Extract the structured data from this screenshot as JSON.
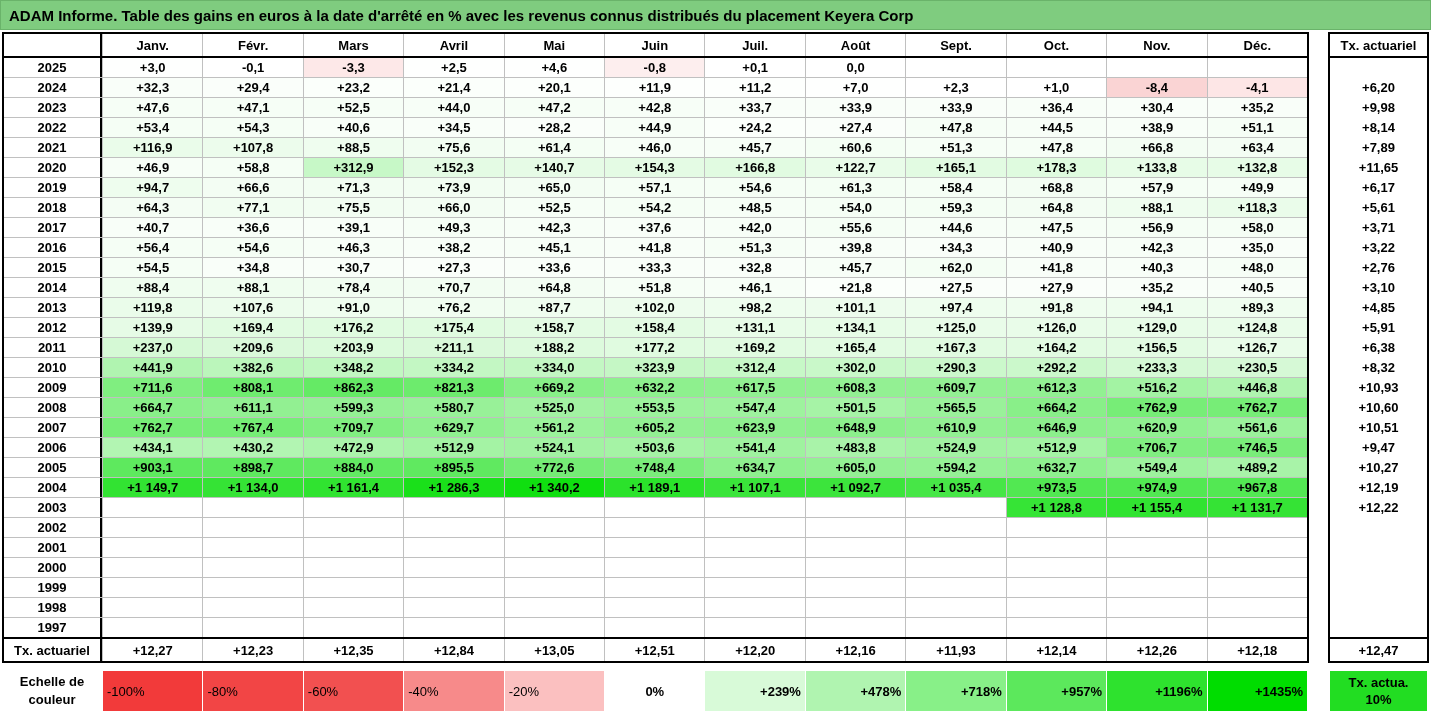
{
  "title": "ADAM Informe. Table des gains en euros à la date d'arrêté en % avec les revenus connus distribués du placement Keyera Corp",
  "columns": [
    "Janv.",
    "Févr.",
    "Mars",
    "Avril",
    "Mai",
    "Juin",
    "Juil.",
    "Août",
    "Sept.",
    "Oct.",
    "Nov.",
    "Déc."
  ],
  "rate_header": "Tx. actuariel",
  "rows": [
    {
      "year": "2025",
      "cells": [
        {
          "text": "+3,0",
          "color": "#fefffe"
        },
        {
          "text": "-0,1",
          "color": "#ffffff"
        },
        {
          "text": "-3,3",
          "color": "#fde8e8"
        },
        {
          "text": "+2,5",
          "color": "#fefffe"
        },
        {
          "text": "+4,6",
          "color": "#fefffe"
        },
        {
          "text": "-0,8",
          "color": "#fdeeee"
        },
        {
          "text": "+0,1",
          "color": "#ffffff"
        },
        {
          "text": "0,0",
          "color": "#ffffff"
        },
        null,
        null,
        null,
        null
      ]
    },
    {
      "year": "2024",
      "cells": [
        {
          "text": "+32,3",
          "color": "#f9fef9"
        },
        {
          "text": "+29,4",
          "color": "#fafefa"
        },
        {
          "text": "+23,2",
          "color": "#fbfffb"
        },
        {
          "text": "+21,4",
          "color": "#fbfffb"
        },
        {
          "text": "+20,1",
          "color": "#fcfffc"
        },
        {
          "text": "+11,9",
          "color": "#fdfffd"
        },
        {
          "text": "+11,2",
          "color": "#fdfffd"
        },
        {
          "text": "+7,0",
          "color": "#fefffe"
        },
        {
          "text": "+2,3",
          "color": "#ffffff"
        },
        {
          "text": "+1,0",
          "color": "#ffffff"
        },
        {
          "text": "-8,4",
          "color": "#fad4d4"
        },
        {
          "text": "-4,1",
          "color": "#fde6e6"
        }
      ],
      "rate": "+6,20"
    },
    {
      "year": "2023",
      "cells": [
        {
          "text": "+47,6",
          "color": "#f6fef6"
        },
        {
          "text": "+47,1",
          "color": "#f6fef6"
        },
        {
          "text": "+52,5",
          "color": "#f6fef6"
        },
        {
          "text": "+44,0",
          "color": "#f7fef7"
        },
        {
          "text": "+47,2",
          "color": "#f6fef6"
        },
        {
          "text": "+42,8",
          "color": "#f7fef7"
        },
        {
          "text": "+33,7",
          "color": "#f9fef9"
        },
        {
          "text": "+33,9",
          "color": "#f9fef9"
        },
        {
          "text": "+33,9",
          "color": "#f9fef9"
        },
        {
          "text": "+36,4",
          "color": "#f8fef8"
        },
        {
          "text": "+30,4",
          "color": "#f9fef9"
        },
        {
          "text": "+35,2",
          "color": "#f9fef9"
        }
      ],
      "rate": "+9,98"
    },
    {
      "year": "2022",
      "cells": [
        {
          "text": "+53,4",
          "color": "#f5fef5"
        },
        {
          "text": "+54,3",
          "color": "#f5fef5"
        },
        {
          "text": "+40,6",
          "color": "#f8fef8"
        },
        {
          "text": "+34,5",
          "color": "#f9fef9"
        },
        {
          "text": "+28,2",
          "color": "#fafefa"
        },
        {
          "text": "+44,9",
          "color": "#f7fef7"
        },
        {
          "text": "+24,2",
          "color": "#fbfffb"
        },
        {
          "text": "+27,4",
          "color": "#fafefa"
        },
        {
          "text": "+47,8",
          "color": "#f6fef6"
        },
        {
          "text": "+44,5",
          "color": "#f7fef7"
        },
        {
          "text": "+38,9",
          "color": "#f8fef8"
        },
        {
          "text": "+51,1",
          "color": "#f6fef6"
        }
      ],
      "rate": "+8,14"
    },
    {
      "year": "2021",
      "cells": [
        {
          "text": "+116,9",
          "color": "#eafcea"
        },
        {
          "text": "+107,8",
          "color": "#ecfcec"
        },
        {
          "text": "+88,5",
          "color": "#effdef"
        },
        {
          "text": "+75,6",
          "color": "#f2fdf2"
        },
        {
          "text": "+61,4",
          "color": "#f4fef4"
        },
        {
          "text": "+46,0",
          "color": "#f7fef7"
        },
        {
          "text": "+45,7",
          "color": "#f7fef7"
        },
        {
          "text": "+60,6",
          "color": "#f4fef4"
        },
        {
          "text": "+51,3",
          "color": "#f6fef6"
        },
        {
          "text": "+47,8",
          "color": "#f6fef6"
        },
        {
          "text": "+66,8",
          "color": "#f3fdf3"
        },
        {
          "text": "+63,4",
          "color": "#f4fdf4"
        }
      ],
      "rate": "+7,89"
    },
    {
      "year": "2020",
      "cells": [
        {
          "text": "+46,9",
          "color": "#f7fef7"
        },
        {
          "text": "+58,8",
          "color": "#f5fef5"
        },
        {
          "text": "+312,9",
          "color": "#c7f8c7"
        },
        {
          "text": "+152,3",
          "color": "#e4fbe4"
        },
        {
          "text": "+140,7",
          "color": "#e6fbe6"
        },
        {
          "text": "+154,3",
          "color": "#e4fbe4"
        },
        {
          "text": "+166,8",
          "color": "#e1fbe1"
        },
        {
          "text": "+122,7",
          "color": "#e9fce9"
        },
        {
          "text": "+165,1",
          "color": "#e2fbe2"
        },
        {
          "text": "+178,3",
          "color": "#dffbdf"
        },
        {
          "text": "+133,8",
          "color": "#e7fce7"
        },
        {
          "text": "+132,8",
          "color": "#e7fce7"
        }
      ],
      "rate": "+11,65"
    },
    {
      "year": "2019",
      "cells": [
        {
          "text": "+94,7",
          "color": "#eefdee"
        },
        {
          "text": "+66,6",
          "color": "#f3fdf3"
        },
        {
          "text": "+71,3",
          "color": "#f2fdf2"
        },
        {
          "text": "+73,9",
          "color": "#f2fdf2"
        },
        {
          "text": "+65,0",
          "color": "#f3fdf3"
        },
        {
          "text": "+57,1",
          "color": "#f5fef5"
        },
        {
          "text": "+54,6",
          "color": "#f5fef5"
        },
        {
          "text": "+61,3",
          "color": "#f4fef4"
        },
        {
          "text": "+58,4",
          "color": "#f5fef5"
        },
        {
          "text": "+68,8",
          "color": "#f3fdf3"
        },
        {
          "text": "+57,9",
          "color": "#f5fef5"
        },
        {
          "text": "+49,9",
          "color": "#f6fef6"
        }
      ],
      "rate": "+6,17"
    },
    {
      "year": "2018",
      "cells": [
        {
          "text": "+64,3",
          "color": "#f4fdf4"
        },
        {
          "text": "+77,1",
          "color": "#f1fdf1"
        },
        {
          "text": "+75,5",
          "color": "#f2fdf2"
        },
        {
          "text": "+66,0",
          "color": "#f3fdf3"
        },
        {
          "text": "+52,5",
          "color": "#f6fef6"
        },
        {
          "text": "+54,2",
          "color": "#f5fef5"
        },
        {
          "text": "+48,5",
          "color": "#f6fef6"
        },
        {
          "text": "+54,0",
          "color": "#f5fef5"
        },
        {
          "text": "+59,3",
          "color": "#f4fef4"
        },
        {
          "text": "+64,8",
          "color": "#f3fdf3"
        },
        {
          "text": "+88,1",
          "color": "#effdef"
        },
        {
          "text": "+118,3",
          "color": "#eafcea"
        }
      ],
      "rate": "+5,61"
    },
    {
      "year": "2017",
      "cells": [
        {
          "text": "+40,7",
          "color": "#f8fef8"
        },
        {
          "text": "+36,6",
          "color": "#f8fef8"
        },
        {
          "text": "+39,1",
          "color": "#f8fef8"
        },
        {
          "text": "+49,3",
          "color": "#f6fef6"
        },
        {
          "text": "+42,3",
          "color": "#f7fef7"
        },
        {
          "text": "+37,6",
          "color": "#f8fef8"
        },
        {
          "text": "+42,0",
          "color": "#f7fef7"
        },
        {
          "text": "+55,6",
          "color": "#f5fef5"
        },
        {
          "text": "+44,6",
          "color": "#f7fef7"
        },
        {
          "text": "+47,5",
          "color": "#f6fef6"
        },
        {
          "text": "+56,9",
          "color": "#f5fef5"
        },
        {
          "text": "+58,0",
          "color": "#f5fef5"
        }
      ],
      "rate": "+3,71"
    },
    {
      "year": "2016",
      "cells": [
        {
          "text": "+56,4",
          "color": "#f5fef5"
        },
        {
          "text": "+54,6",
          "color": "#f5fef5"
        },
        {
          "text": "+46,3",
          "color": "#f7fef7"
        },
        {
          "text": "+38,2",
          "color": "#f8fef8"
        },
        {
          "text": "+45,1",
          "color": "#f7fef7"
        },
        {
          "text": "+41,8",
          "color": "#f8fef8"
        },
        {
          "text": "+51,3",
          "color": "#f6fef6"
        },
        {
          "text": "+39,8",
          "color": "#f8fef8"
        },
        {
          "text": "+34,3",
          "color": "#f9fef9"
        },
        {
          "text": "+40,9",
          "color": "#f8fef8"
        },
        {
          "text": "+42,3",
          "color": "#f7fef7"
        },
        {
          "text": "+35,0",
          "color": "#f9fef9"
        }
      ],
      "rate": "+3,22"
    },
    {
      "year": "2015",
      "cells": [
        {
          "text": "+54,5",
          "color": "#f5fef5"
        },
        {
          "text": "+34,8",
          "color": "#f9fef9"
        },
        {
          "text": "+30,7",
          "color": "#f9fef9"
        },
        {
          "text": "+27,3",
          "color": "#fafefa"
        },
        {
          "text": "+33,6",
          "color": "#f9fef9"
        },
        {
          "text": "+33,3",
          "color": "#f9fef9"
        },
        {
          "text": "+32,8",
          "color": "#f9fef9"
        },
        {
          "text": "+45,7",
          "color": "#f7fef7"
        },
        {
          "text": "+62,0",
          "color": "#f4fef4"
        },
        {
          "text": "+41,8",
          "color": "#f8fef8"
        },
        {
          "text": "+40,3",
          "color": "#f8fef8"
        },
        {
          "text": "+48,0",
          "color": "#f6fef6"
        }
      ],
      "rate": "+2,76"
    },
    {
      "year": "2014",
      "cells": [
        {
          "text": "+88,4",
          "color": "#effdef"
        },
        {
          "text": "+88,1",
          "color": "#effdef"
        },
        {
          "text": "+78,4",
          "color": "#f1fdf1"
        },
        {
          "text": "+70,7",
          "color": "#f2fdf2"
        },
        {
          "text": "+64,8",
          "color": "#f3fdf3"
        },
        {
          "text": "+51,8",
          "color": "#f6fef6"
        },
        {
          "text": "+46,1",
          "color": "#f7fef7"
        },
        {
          "text": "+21,8",
          "color": "#fbfffb"
        },
        {
          "text": "+27,5",
          "color": "#fafefa"
        },
        {
          "text": "+27,9",
          "color": "#fafefa"
        },
        {
          "text": "+35,2",
          "color": "#f9fef9"
        },
        {
          "text": "+40,5",
          "color": "#f8fef8"
        }
      ],
      "rate": "+3,10"
    },
    {
      "year": "2013",
      "cells": [
        {
          "text": "+119,8",
          "color": "#eafcea"
        },
        {
          "text": "+107,6",
          "color": "#ecfcec"
        },
        {
          "text": "+91,0",
          "color": "#effdef"
        },
        {
          "text": "+76,2",
          "color": "#f1fdf1"
        },
        {
          "text": "+87,7",
          "color": "#effdef"
        },
        {
          "text": "+102,0",
          "color": "#edfced"
        },
        {
          "text": "+98,2",
          "color": "#eefdee"
        },
        {
          "text": "+101,1",
          "color": "#edfced"
        },
        {
          "text": "+97,4",
          "color": "#eefdee"
        },
        {
          "text": "+91,8",
          "color": "#effdef"
        },
        {
          "text": "+94,1",
          "color": "#eefdee"
        },
        {
          "text": "+89,3",
          "color": "#effdef"
        }
      ],
      "rate": "+4,85"
    },
    {
      "year": "2012",
      "cells": [
        {
          "text": "+139,9",
          "color": "#e6fbe6"
        },
        {
          "text": "+169,4",
          "color": "#e1fbe1"
        },
        {
          "text": "+176,2",
          "color": "#e0fbe0"
        },
        {
          "text": "+175,4",
          "color": "#e0fbe0"
        },
        {
          "text": "+158,7",
          "color": "#e3fbe3"
        },
        {
          "text": "+158,4",
          "color": "#e3fbe3"
        },
        {
          "text": "+131,1",
          "color": "#e8fce8"
        },
        {
          "text": "+134,1",
          "color": "#e7fce7"
        },
        {
          "text": "+125,0",
          "color": "#e9fce9"
        },
        {
          "text": "+126,0",
          "color": "#e9fce9"
        },
        {
          "text": "+129,0",
          "color": "#e8fce8"
        },
        {
          "text": "+124,8",
          "color": "#e9fce9"
        }
      ],
      "rate": "+5,91"
    },
    {
      "year": "2011",
      "cells": [
        {
          "text": "+237,0",
          "color": "#d5f9d5"
        },
        {
          "text": "+209,6",
          "color": "#daf9da"
        },
        {
          "text": "+203,9",
          "color": "#dbfadb"
        },
        {
          "text": "+211,1",
          "color": "#daf9da"
        },
        {
          "text": "+188,2",
          "color": "#ddfadd"
        },
        {
          "text": "+177,2",
          "color": "#e0fbe0"
        },
        {
          "text": "+169,2",
          "color": "#e1fbe1"
        },
        {
          "text": "+165,4",
          "color": "#e2fbe2"
        },
        {
          "text": "+167,3",
          "color": "#e1fbe1"
        },
        {
          "text": "+164,2",
          "color": "#e2fbe2"
        },
        {
          "text": "+156,5",
          "color": "#e3fbe3"
        },
        {
          "text": "+126,7",
          "color": "#e9fce9"
        }
      ],
      "rate": "+6,38"
    },
    {
      "year": "2010",
      "cells": [
        {
          "text": "+441,9",
          "color": "#b0f4b0"
        },
        {
          "text": "+382,6",
          "color": "#bbf6bb"
        },
        {
          "text": "+348,2",
          "color": "#c1f7c1"
        },
        {
          "text": "+334,2",
          "color": "#c3f7c3"
        },
        {
          "text": "+334,0",
          "color": "#c3f7c3"
        },
        {
          "text": "+323,9",
          "color": "#c5f7c5"
        },
        {
          "text": "+312,4",
          "color": "#c7f8c7"
        },
        {
          "text": "+302,0",
          "color": "#c9f8c9"
        },
        {
          "text": "+290,3",
          "color": "#cbf8cb"
        },
        {
          "text": "+292,2",
          "color": "#cbf8cb"
        },
        {
          "text": "+233,3",
          "color": "#d5f9d5"
        },
        {
          "text": "+230,5",
          "color": "#d6f9d6"
        }
      ],
      "rate": "+8,32"
    },
    {
      "year": "2009",
      "cells": [
        {
          "text": "+711,6",
          "color": "#80ee80"
        },
        {
          "text": "+808,1",
          "color": "#6fec6f"
        },
        {
          "text": "+862,3",
          "color": "#65ea65"
        },
        {
          "text": "+821,3",
          "color": "#6deb6d"
        },
        {
          "text": "+669,2",
          "color": "#88ef88"
        },
        {
          "text": "+632,2",
          "color": "#8ef08e"
        },
        {
          "text": "+617,5",
          "color": "#91f091"
        },
        {
          "text": "+608,3",
          "color": "#93f093"
        },
        {
          "text": "+609,7",
          "color": "#93f093"
        },
        {
          "text": "+612,3",
          "color": "#92f092"
        },
        {
          "text": "+516,2",
          "color": "#a3f3a3"
        },
        {
          "text": "+446,8",
          "color": "#aff4af"
        }
      ],
      "rate": "+10,93"
    },
    {
      "year": "2008",
      "cells": [
        {
          "text": "+664,7",
          "color": "#89ef89"
        },
        {
          "text": "+611,1",
          "color": "#92f092"
        },
        {
          "text": "+599,3",
          "color": "#94f094"
        },
        {
          "text": "+580,7",
          "color": "#98f198"
        },
        {
          "text": "+525,0",
          "color": "#a2f2a2"
        },
        {
          "text": "+553,5",
          "color": "#9cf29c"
        },
        {
          "text": "+547,4",
          "color": "#9ef29e"
        },
        {
          "text": "+501,5",
          "color": "#a6f3a6"
        },
        {
          "text": "+565,5",
          "color": "#9af19a"
        },
        {
          "text": "+664,2",
          "color": "#89ef89"
        },
        {
          "text": "+762,9",
          "color": "#77ed77"
        },
        {
          "text": "+762,7",
          "color": "#77ed77"
        }
      ],
      "rate": "+10,60"
    },
    {
      "year": "2007",
      "cells": [
        {
          "text": "+762,7",
          "color": "#77ed77"
        },
        {
          "text": "+767,4",
          "color": "#76ed76"
        },
        {
          "text": "+709,7",
          "color": "#81ee81"
        },
        {
          "text": "+629,7",
          "color": "#8ff08f"
        },
        {
          "text": "+561,2",
          "color": "#9bf29b"
        },
        {
          "text": "+605,2",
          "color": "#93f093"
        },
        {
          "text": "+623,9",
          "color": "#90f090"
        },
        {
          "text": "+648,9",
          "color": "#8cef8c"
        },
        {
          "text": "+610,9",
          "color": "#92f092"
        },
        {
          "text": "+646,9",
          "color": "#8cef8c"
        },
        {
          "text": "+620,9",
          "color": "#90f090"
        },
        {
          "text": "+561,6",
          "color": "#9bf29b"
        }
      ],
      "rate": "+10,51"
    },
    {
      "year": "2006",
      "cells": [
        {
          "text": "+434,1",
          "color": "#b2f5b2"
        },
        {
          "text": "+430,2",
          "color": "#b2f5b2"
        },
        {
          "text": "+472,9",
          "color": "#abf4ab"
        },
        {
          "text": "+512,9",
          "color": "#a4f3a4"
        },
        {
          "text": "+524,1",
          "color": "#a2f2a2"
        },
        {
          "text": "+503,6",
          "color": "#a5f3a5"
        },
        {
          "text": "+541,4",
          "color": "#9ff29f"
        },
        {
          "text": "+483,8",
          "color": "#a9f3a9"
        },
        {
          "text": "+524,9",
          "color": "#a2f2a2"
        },
        {
          "text": "+512,9",
          "color": "#a4f3a4"
        },
        {
          "text": "+706,7",
          "color": "#81ee81"
        },
        {
          "text": "+746,5",
          "color": "#7aed7a"
        }
      ],
      "rate": "+9,47"
    },
    {
      "year": "2005",
      "cells": [
        {
          "text": "+903,1",
          "color": "#5ee95e"
        },
        {
          "text": "+898,7",
          "color": "#5fe95f"
        },
        {
          "text": "+884,0",
          "color": "#62ea62"
        },
        {
          "text": "+895,5",
          "color": "#60e960"
        },
        {
          "text": "+772,6",
          "color": "#75ec75"
        },
        {
          "text": "+748,4",
          "color": "#7aed7a"
        },
        {
          "text": "+634,7",
          "color": "#8ef08e"
        },
        {
          "text": "+605,0",
          "color": "#93f093"
        },
        {
          "text": "+594,2",
          "color": "#95f195"
        },
        {
          "text": "+632,7",
          "color": "#8ef08e"
        },
        {
          "text": "+549,4",
          "color": "#9df29d"
        },
        {
          "text": "+489,2",
          "color": "#a8f3a8"
        }
      ],
      "rate": "+10,27"
    },
    {
      "year": "2004",
      "cells": [
        {
          "text": "+1 149,7",
          "color": "#32e332"
        },
        {
          "text": "+1 134,0",
          "color": "#35e335"
        },
        {
          "text": "+1 161,4",
          "color": "#30e330"
        },
        {
          "text": "+1 286,3",
          "color": "#1ae01a"
        },
        {
          "text": "+1 340,2",
          "color": "#10df10"
        },
        {
          "text": "+1 189,1",
          "color": "#2be22b"
        },
        {
          "text": "+1 107,1",
          "color": "#3ae43a"
        },
        {
          "text": "+1 092,7",
          "color": "#3ce43c"
        },
        {
          "text": "+1 035,4",
          "color": "#47e647"
        },
        {
          "text": "+973,5",
          "color": "#52e852"
        },
        {
          "text": "+974,9",
          "color": "#52e852"
        },
        {
          "text": "+967,8",
          "color": "#53e853"
        }
      ],
      "rate": "+12,19"
    },
    {
      "year": "2003",
      "cells": [
        null,
        null,
        null,
        null,
        null,
        null,
        null,
        null,
        null,
        {
          "text": "+1 128,8",
          "color": "#36e436"
        },
        {
          "text": "+1 155,4",
          "color": "#31e331"
        },
        {
          "text": "+1 131,7",
          "color": "#35e335"
        }
      ],
      "rate": "+12,22"
    },
    {
      "year": "2002",
      "cells": [
        null,
        null,
        null,
        null,
        null,
        null,
        null,
        null,
        null,
        null,
        null,
        null
      ]
    },
    {
      "year": "2001",
      "cells": [
        null,
        null,
        null,
        null,
        null,
        null,
        null,
        null,
        null,
        null,
        null,
        null
      ]
    },
    {
      "year": "2000",
      "cells": [
        null,
        null,
        null,
        null,
        null,
        null,
        null,
        null,
        null,
        null,
        null,
        null
      ]
    },
    {
      "year": "1999",
      "cells": [
        null,
        null,
        null,
        null,
        null,
        null,
        null,
        null,
        null,
        null,
        null,
        null
      ]
    },
    {
      "year": "1998",
      "cells": [
        null,
        null,
        null,
        null,
        null,
        null,
        null,
        null,
        null,
        null,
        null,
        null
      ]
    },
    {
      "year": "1997",
      "cells": [
        null,
        null,
        null,
        null,
        null,
        null,
        null,
        null,
        null,
        null,
        null,
        null
      ]
    }
  ],
  "total": {
    "label": "Tx. actuariel",
    "cells": [
      "+12,27",
      "+12,23",
      "+12,35",
      "+12,84",
      "+13,05",
      "+12,51",
      "+12,20",
      "+12,16",
      "+11,93",
      "+12,14",
      "+12,26",
      "+12,18"
    ],
    "rate": "+12,47"
  },
  "legend": {
    "label": "Echelle de couleur",
    "swatches": [
      {
        "text": "-100%",
        "color": "#f23a3a",
        "kind": "negative"
      },
      {
        "text": "-80%",
        "color": "#f24545",
        "kind": "negative"
      },
      {
        "text": "-60%",
        "color": "#f25050",
        "kind": "negative"
      },
      {
        "text": "-40%",
        "color": "#f78a8a",
        "kind": "negative"
      },
      {
        "text": "-20%",
        "color": "#fbc0c0",
        "kind": "negative"
      },
      {
        "text": "0%",
        "color": "#ffffff",
        "kind": "zero"
      },
      {
        "text": "+239%",
        "color": "#d8fad8",
        "kind": "positive"
      },
      {
        "text": "+478%",
        "color": "#b0f4b0",
        "kind": "positive"
      },
      {
        "text": "+718%",
        "color": "#88f088",
        "kind": "positive"
      },
      {
        "text": "+957%",
        "color": "#5ce85c",
        "kind": "positive"
      },
      {
        "text": "+1196%",
        "color": "#2ee22e",
        "kind": "positive"
      },
      {
        "text": "+1435%",
        "color": "#00dd00",
        "kind": "positive"
      }
    ],
    "rate_swatch": {
      "text": "Tx. actua. 10%",
      "color": "#22dd22"
    }
  }
}
